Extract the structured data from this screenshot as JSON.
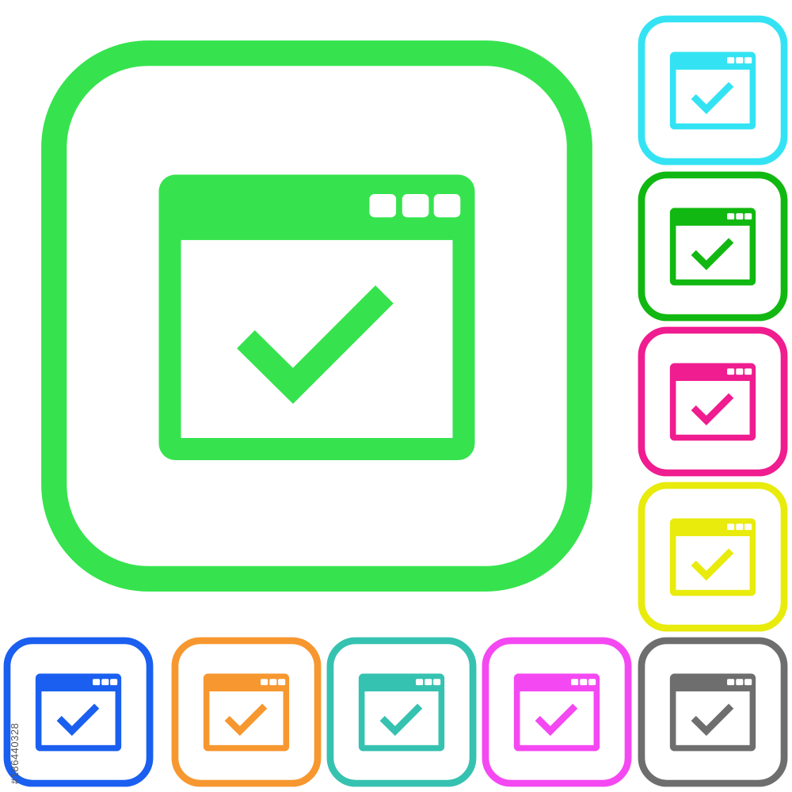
{
  "icon_name": "app-window-check-icon",
  "stock_id": "#186440328",
  "variants": [
    {
      "id": "main",
      "color": "#36e34e"
    },
    {
      "id": "cyan",
      "color": "#33e3f3"
    },
    {
      "id": "green",
      "color": "#11b811"
    },
    {
      "id": "pink",
      "color": "#ef1d8f"
    },
    {
      "id": "yellow",
      "color": "#e8eb0c"
    },
    {
      "id": "blue",
      "color": "#1a5fef"
    },
    {
      "id": "orange",
      "color": "#f7972f"
    },
    {
      "id": "teal",
      "color": "#36c2b0"
    },
    {
      "id": "violet",
      "color": "#f448f2"
    },
    {
      "id": "gray",
      "color": "#6e6e6e"
    }
  ]
}
